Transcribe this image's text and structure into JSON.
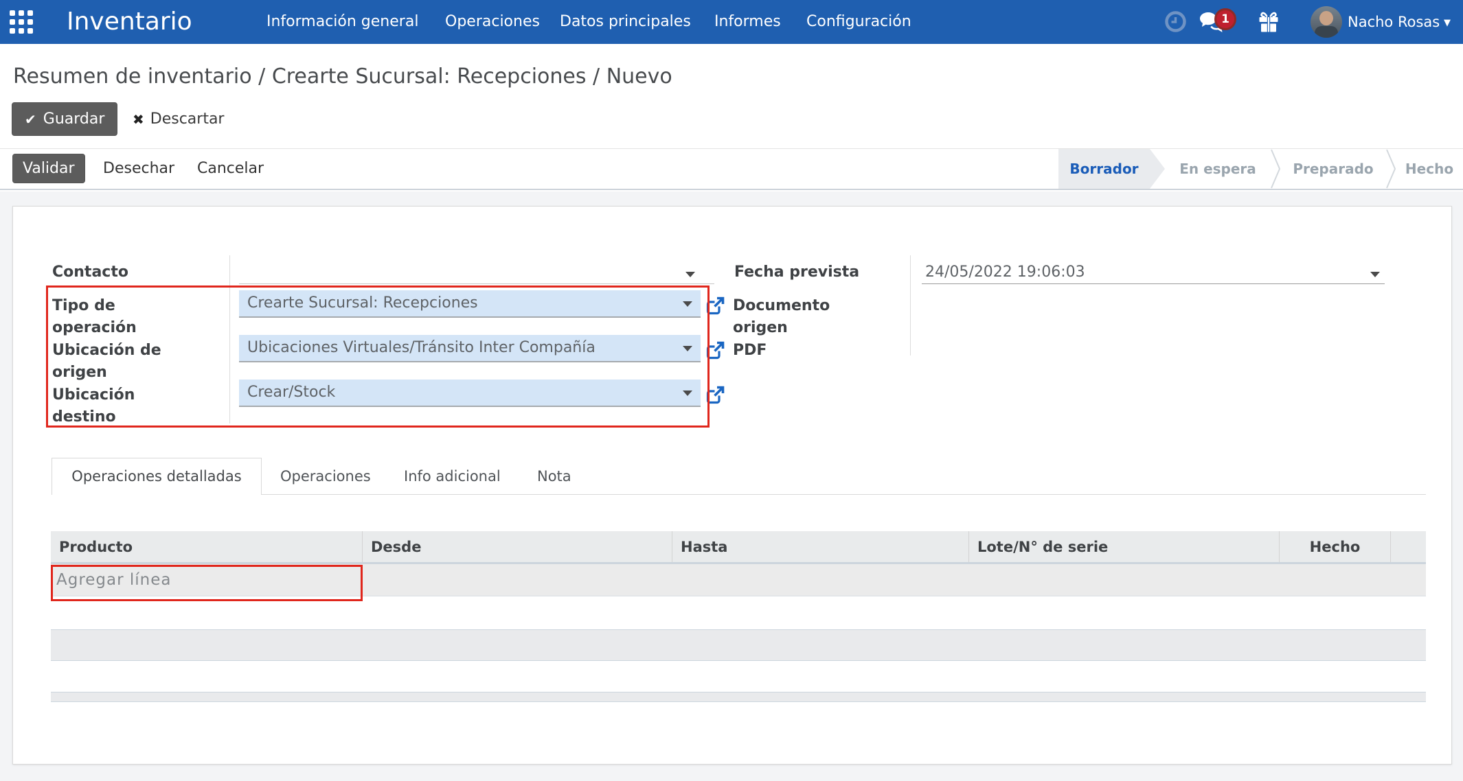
{
  "navbar": {
    "brand": "Inventario",
    "menus": [
      "Información general",
      "Operaciones",
      "Datos principales",
      "Informes",
      "Configuración"
    ],
    "badge_count": "1",
    "user_name": "Nacho Rosas"
  },
  "breadcrumb": {
    "parts": [
      "Resumen de inventario",
      "Crearte Sucursal: Recepciones",
      "Nuevo"
    ]
  },
  "actions": {
    "save": "Guardar",
    "discard": "Descartar",
    "validate": "Validar",
    "scrap": "Desechar",
    "cancel": "Cancelar"
  },
  "statusbar": {
    "stages": [
      "Borrador",
      "En espera",
      "Preparado",
      "Hecho"
    ],
    "active_stage": "Borrador"
  },
  "form": {
    "contact_label": "Contacto",
    "contact_value": "",
    "operation_type_label": "Tipo de operación",
    "operation_type_value": "Crearte Sucursal: Recepciones",
    "source_location_label": "Ubicación de origen",
    "source_location_value": "Ubicaciones Virtuales/Tránsito Inter Compañía",
    "dest_location_label": "Ubicación destino",
    "dest_location_value": "Crear/Stock",
    "scheduled_date_label": "Fecha prevista",
    "scheduled_date_value": "24/05/2022 19:06:03",
    "source_document_label": "Documento origen",
    "pdf_label": "PDF"
  },
  "tabs": [
    "Operaciones detalladas",
    "Operaciones",
    "Info adicional",
    "Nota"
  ],
  "table": {
    "headers": [
      "Producto",
      "Desde",
      "Hasta",
      "Lote/N° de serie",
      "Hecho"
    ],
    "add_line": "Agregar línea"
  },
  "colors": {
    "navbar_bg": "#1f5fb0",
    "field_bg": "#d4e5f7",
    "highlight_red": "#e0261c",
    "link_blue": "#1a66c2",
    "active_stage_text": "#1a5cb8"
  }
}
